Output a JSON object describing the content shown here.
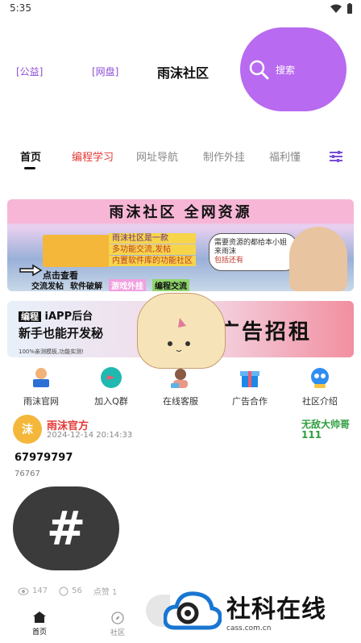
{
  "status_bar": {
    "time": "5:35"
  },
  "header": {
    "link_left": "[公益]",
    "link_mid": "[网盘]",
    "title": "雨沫社区",
    "search_label": "搜索"
  },
  "tabs": [
    {
      "label": "首页"
    },
    {
      "label": "编程学习"
    },
    {
      "label": "网址导航"
    },
    {
      "label": "制作外挂"
    },
    {
      "label": "福利懂"
    }
  ],
  "banner1": {
    "headline": "雨沫社区  全网资源",
    "chips": [
      "雨沫社区是一款",
      "多功能交流,发帖",
      "内置软件库的功能社区"
    ],
    "bubble": "需要资源的都给本小姐来雨沫",
    "bubble2": "包括还有",
    "cta": "点击查看",
    "tags": [
      "交流发帖",
      "软件破解",
      "游戏外挂",
      "编程交流"
    ]
  },
  "banner2": {
    "left_badge": "编程",
    "left_line1": "iAPP后台",
    "left_line2": "新手也能开发秘",
    "left_small": "100%亲测模板,功能实测!",
    "right_text": "广告招租"
  },
  "quick_links": [
    {
      "label": "雨沫官网",
      "icon": "reader-icon",
      "color": "#2c6fd6"
    },
    {
      "label": "加入Q群",
      "icon": "chat-bubble-icon",
      "color": "#20b8b0"
    },
    {
      "label": "在线客服",
      "icon": "customer-service-icon",
      "color": "#e8998a"
    },
    {
      "label": "广告合作",
      "icon": "gift-icon",
      "color": "#1e88e5"
    },
    {
      "label": "社区介绍",
      "icon": "robot-icon",
      "color": "#2f8ef0"
    }
  ],
  "post": {
    "author": "雨沫官方",
    "avatar_text": "沫",
    "time": "2024-12-14 20:14:33",
    "vip_name": "无敌大帅哥",
    "vip_number": "111",
    "title": "67979797",
    "body": "76767",
    "image_symbol": "#",
    "views": "147",
    "comments": "56",
    "likes": "点赞 1"
  },
  "bottom_nav": [
    {
      "label": "首页",
      "icon": "home-icon"
    },
    {
      "label": "社区",
      "icon": "compass-icon"
    }
  ],
  "watermark": {
    "text": "社科在线",
    "url": "cass.com.cn"
  },
  "colors": {
    "accent": "#b86af0",
    "link": "#8c4dd6",
    "red": "#e53935",
    "green": "#2e9e3e"
  }
}
